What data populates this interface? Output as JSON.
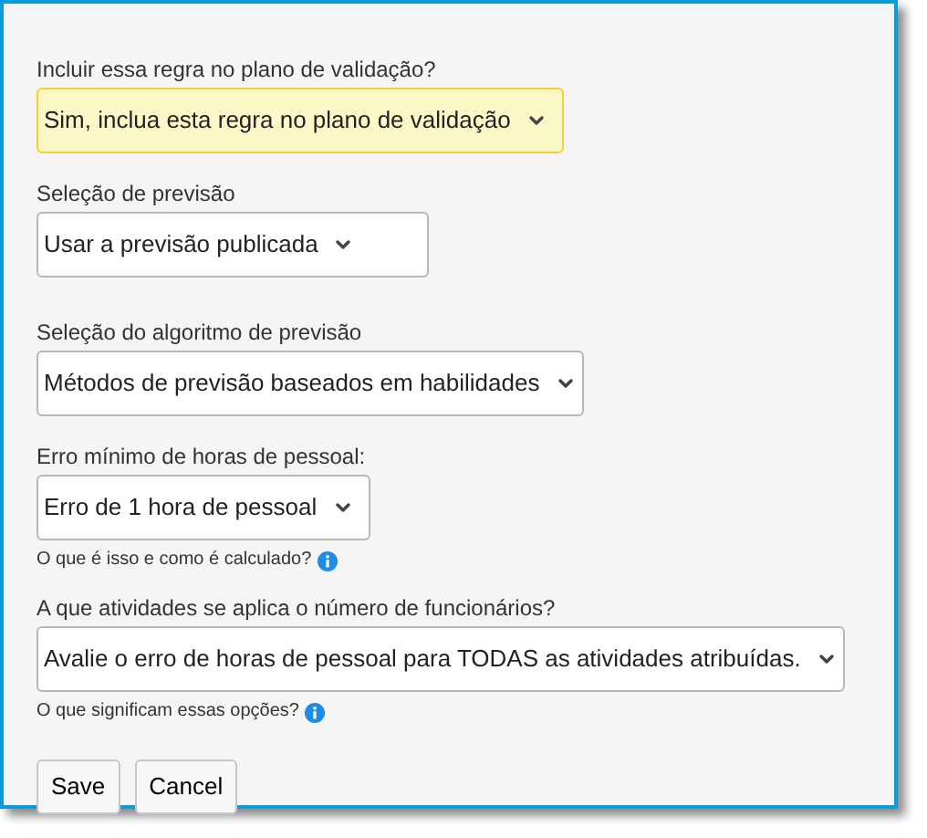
{
  "fields": [
    {
      "label": "Incluir essa regra no plano de validação?",
      "value": "Sim, inclua esta regra no plano de validação",
      "highlighted": true
    },
    {
      "label": "Seleção de previsão",
      "value": "Usar a previsão publicada",
      "highlighted": false
    },
    {
      "label": "Seleção do algoritmo de previsão",
      "value": "Métodos de previsão baseados em habilidades",
      "highlighted": false
    },
    {
      "label": "Erro mínimo de horas de pessoal:",
      "value": "Erro de 1 hora de pessoal",
      "highlighted": false,
      "help": "O que é isso e como é calculado?"
    },
    {
      "label": "A que atividades se aplica o número de funcionários?",
      "value": "Avalie o erro de horas de pessoal para TODAS as atividades atribuídas.",
      "highlighted": false,
      "help": "O que significam essas opções?"
    }
  ],
  "buttons": [
    "Save",
    "Cancel"
  ]
}
